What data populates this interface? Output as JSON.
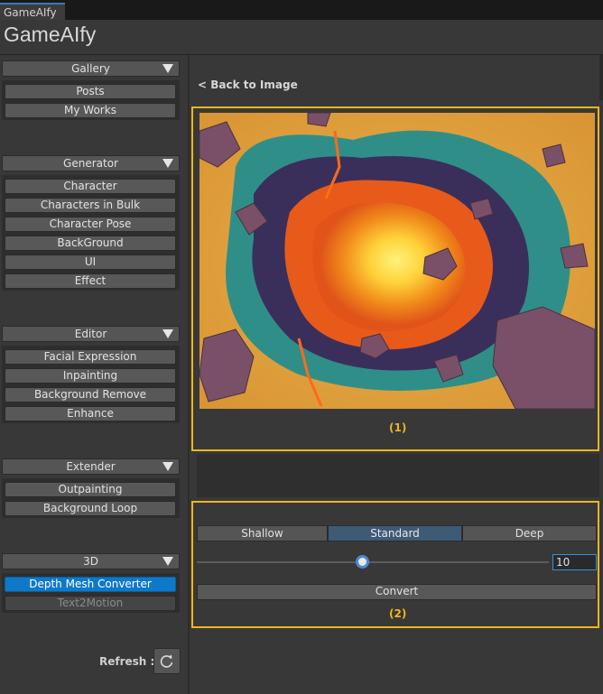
{
  "window": {
    "tab": "GameAIfy",
    "title": "GameAIfy"
  },
  "sidebar": {
    "sections": [
      {
        "title": "Gallery",
        "items": [
          "Posts",
          "My Works"
        ]
      },
      {
        "title": "Generator",
        "items": [
          "Character",
          "Characters in Bulk",
          "Character Pose",
          "BackGround",
          "UI",
          "Effect"
        ]
      },
      {
        "title": "Editor",
        "items": [
          "Facial Expression",
          "Inpainting",
          "Background Remove",
          "Enhance"
        ]
      },
      {
        "title": "Extender",
        "items": [
          "Outpainting",
          "Background Loop"
        ]
      },
      {
        "title": "3D",
        "items": [
          "Depth Mesh Converter",
          "Text2Motion"
        ]
      }
    ],
    "refresh_label": "Refresh :",
    "refresh_icon": "refresh-icon"
  },
  "main": {
    "back_link": "< Back to Image",
    "frame1_label": "(1)",
    "frame2_label": "(2)",
    "depth_options": [
      "Shallow",
      "Standard",
      "Deep"
    ],
    "depth_selected": "Standard",
    "slider_value": "10",
    "convert_label": "Convert"
  },
  "colors": {
    "accent": "#0f79c9",
    "highlight_frame": "#f1b51c",
    "selected_segment": "#3f5a74"
  }
}
